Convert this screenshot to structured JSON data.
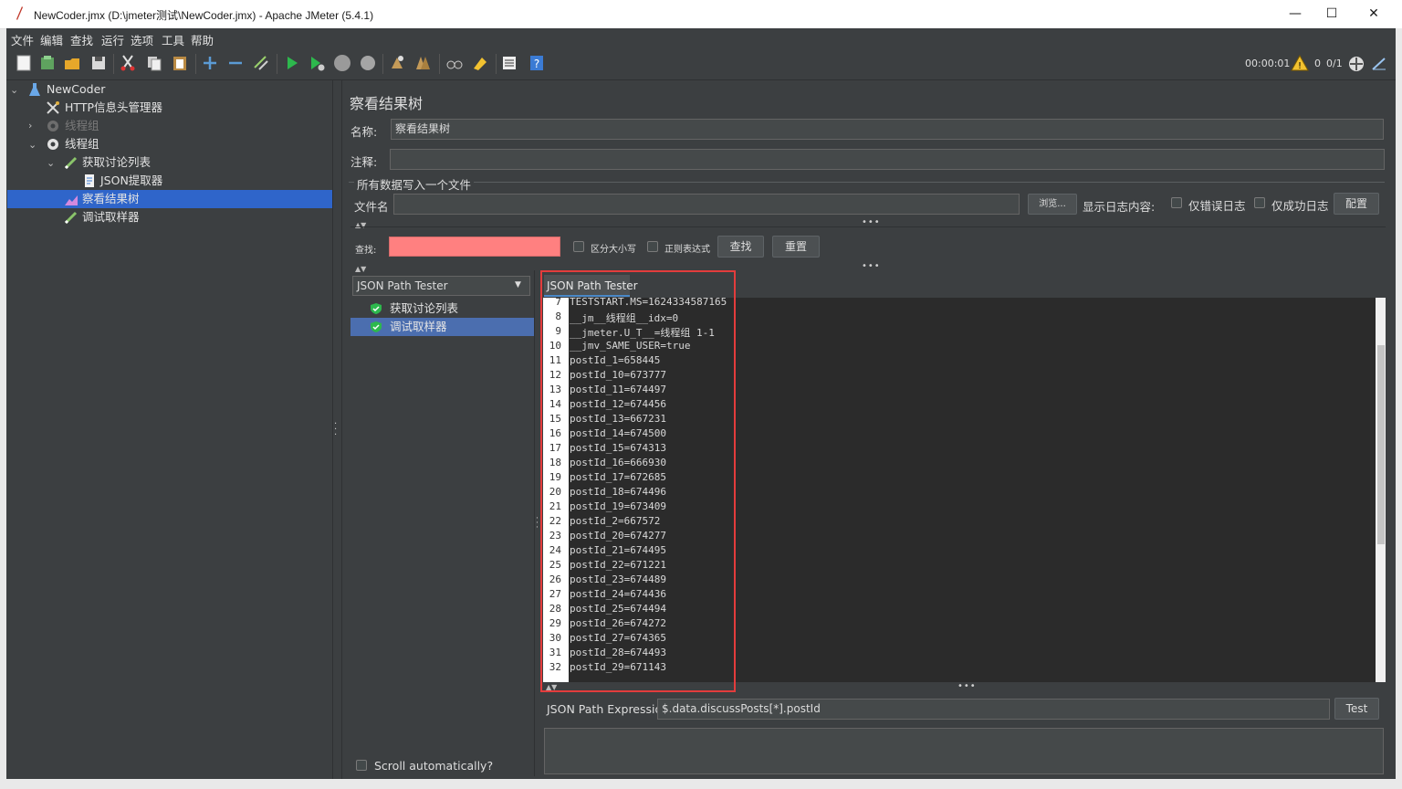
{
  "window": {
    "title": "NewCoder.jmx (D:\\jmeter测试\\NewCoder.jmx) - Apache JMeter (5.4.1)",
    "minimize": "—",
    "maximize": "☐",
    "close": "✕"
  },
  "menu": [
    "文件",
    "编辑",
    "查找",
    "运行",
    "选项",
    "工具",
    "帮助"
  ],
  "toolbar": {
    "timer": "00:00:01",
    "warn_count": "0",
    "threads": "0/1",
    "icons": [
      "new-icon",
      "templates-icon",
      "open-icon",
      "save-icon",
      "cut-icon",
      "copy-icon",
      "paste-icon",
      "expand-icon",
      "collapse-icon",
      "toggle-icon",
      "start-icon",
      "start-no-pause-icon",
      "stop-icon",
      "shutdown-icon",
      "clear-icon",
      "clear-all-icon",
      "search-icon",
      "reset-search-icon",
      "function-helper-icon",
      "help-icon"
    ]
  },
  "tree": {
    "root": "NewCoder",
    "items": [
      {
        "label": "HTTP信息头管理器"
      },
      {
        "label": "线程组"
      },
      {
        "label": "线程组"
      },
      {
        "label": "获取讨论列表"
      },
      {
        "label": "JSON提取器"
      },
      {
        "label": "察看结果树"
      },
      {
        "label": "调试取样器"
      }
    ]
  },
  "panel": {
    "title": "察看结果树",
    "name_label": "名称:",
    "name_value": "察看结果树",
    "comment_label": "注释:",
    "comment_value": "",
    "group_title": "所有数据写入一个文件",
    "filename_label": "文件名",
    "browse": "浏览...",
    "log_label": "显示日志内容:",
    "errors_only": "仅错误日志",
    "success_only": "仅成功日志",
    "configure": "配置",
    "search_label": "查找:",
    "case_sensitive": "区分大小写",
    "regex": "正则表达式",
    "find": "查找",
    "reset": "重置",
    "renderer": "JSON Path Tester",
    "tab": "JSON Path Tester",
    "results": [
      "获取讨论列表",
      "调试取样器"
    ],
    "scroll_auto": "Scroll automatically?",
    "expr_label": "JSON Path Expression",
    "expr_value": "$.data.discussPosts[*].postId",
    "test": "Test"
  },
  "code_lines": [
    {
      "n": "7",
      "t": "TESTSTART.MS=1624334587165"
    },
    {
      "n": "8",
      "t": "__jm__线程组__idx=0"
    },
    {
      "n": "9",
      "t": "__jmeter.U_T__=线程组 1-1"
    },
    {
      "n": "10",
      "t": "__jmv_SAME_USER=true"
    },
    {
      "n": "11",
      "t": "postId_1=658445"
    },
    {
      "n": "12",
      "t": "postId_10=673777"
    },
    {
      "n": "13",
      "t": "postId_11=674497"
    },
    {
      "n": "14",
      "t": "postId_12=674456"
    },
    {
      "n": "15",
      "t": "postId_13=667231"
    },
    {
      "n": "16",
      "t": "postId_14=674500"
    },
    {
      "n": "17",
      "t": "postId_15=674313"
    },
    {
      "n": "18",
      "t": "postId_16=666930"
    },
    {
      "n": "19",
      "t": "postId_17=672685"
    },
    {
      "n": "20",
      "t": "postId_18=674496"
    },
    {
      "n": "21",
      "t": "postId_19=673409"
    },
    {
      "n": "22",
      "t": "postId_2=667572"
    },
    {
      "n": "23",
      "t": "postId_20=674277"
    },
    {
      "n": "24",
      "t": "postId_21=674495"
    },
    {
      "n": "25",
      "t": "postId_22=671221"
    },
    {
      "n": "26",
      "t": "postId_23=674489"
    },
    {
      "n": "27",
      "t": "postId_24=674436"
    },
    {
      "n": "28",
      "t": "postId_25=674494"
    },
    {
      "n": "29",
      "t": "postId_26=674272"
    },
    {
      "n": "30",
      "t": "postId_27=674365"
    },
    {
      "n": "31",
      "t": "postId_28=674493"
    },
    {
      "n": "32",
      "t": "postId_29=671143"
    }
  ]
}
